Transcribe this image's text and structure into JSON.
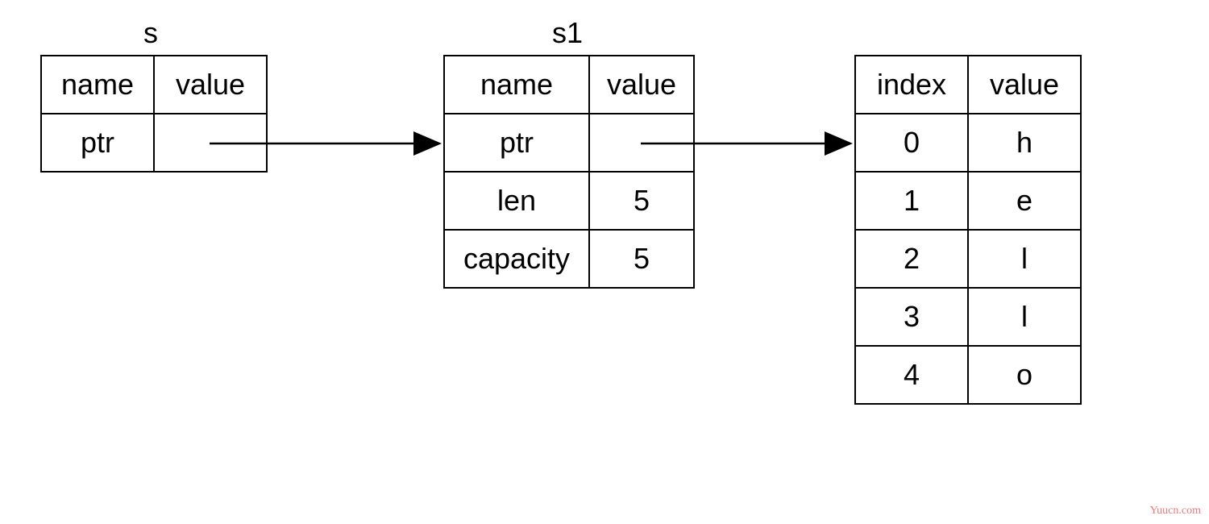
{
  "table_s": {
    "title": "s",
    "headers": {
      "col1": "name",
      "col2": "value"
    },
    "rows": [
      {
        "name": "ptr",
        "value": ""
      }
    ]
  },
  "table_s1": {
    "title": "s1",
    "headers": {
      "col1": "name",
      "col2": "value"
    },
    "rows": [
      {
        "name": "ptr",
        "value": ""
      },
      {
        "name": "len",
        "value": "5"
      },
      {
        "name": "capacity",
        "value": "5"
      }
    ]
  },
  "table_heap": {
    "headers": {
      "col1": "index",
      "col2": "value"
    },
    "rows": [
      {
        "index": "0",
        "value": "h"
      },
      {
        "index": "1",
        "value": "e"
      },
      {
        "index": "2",
        "value": "l"
      },
      {
        "index": "3",
        "value": "l"
      },
      {
        "index": "4",
        "value": "o"
      }
    ]
  },
  "watermark": "Yuucn.com"
}
